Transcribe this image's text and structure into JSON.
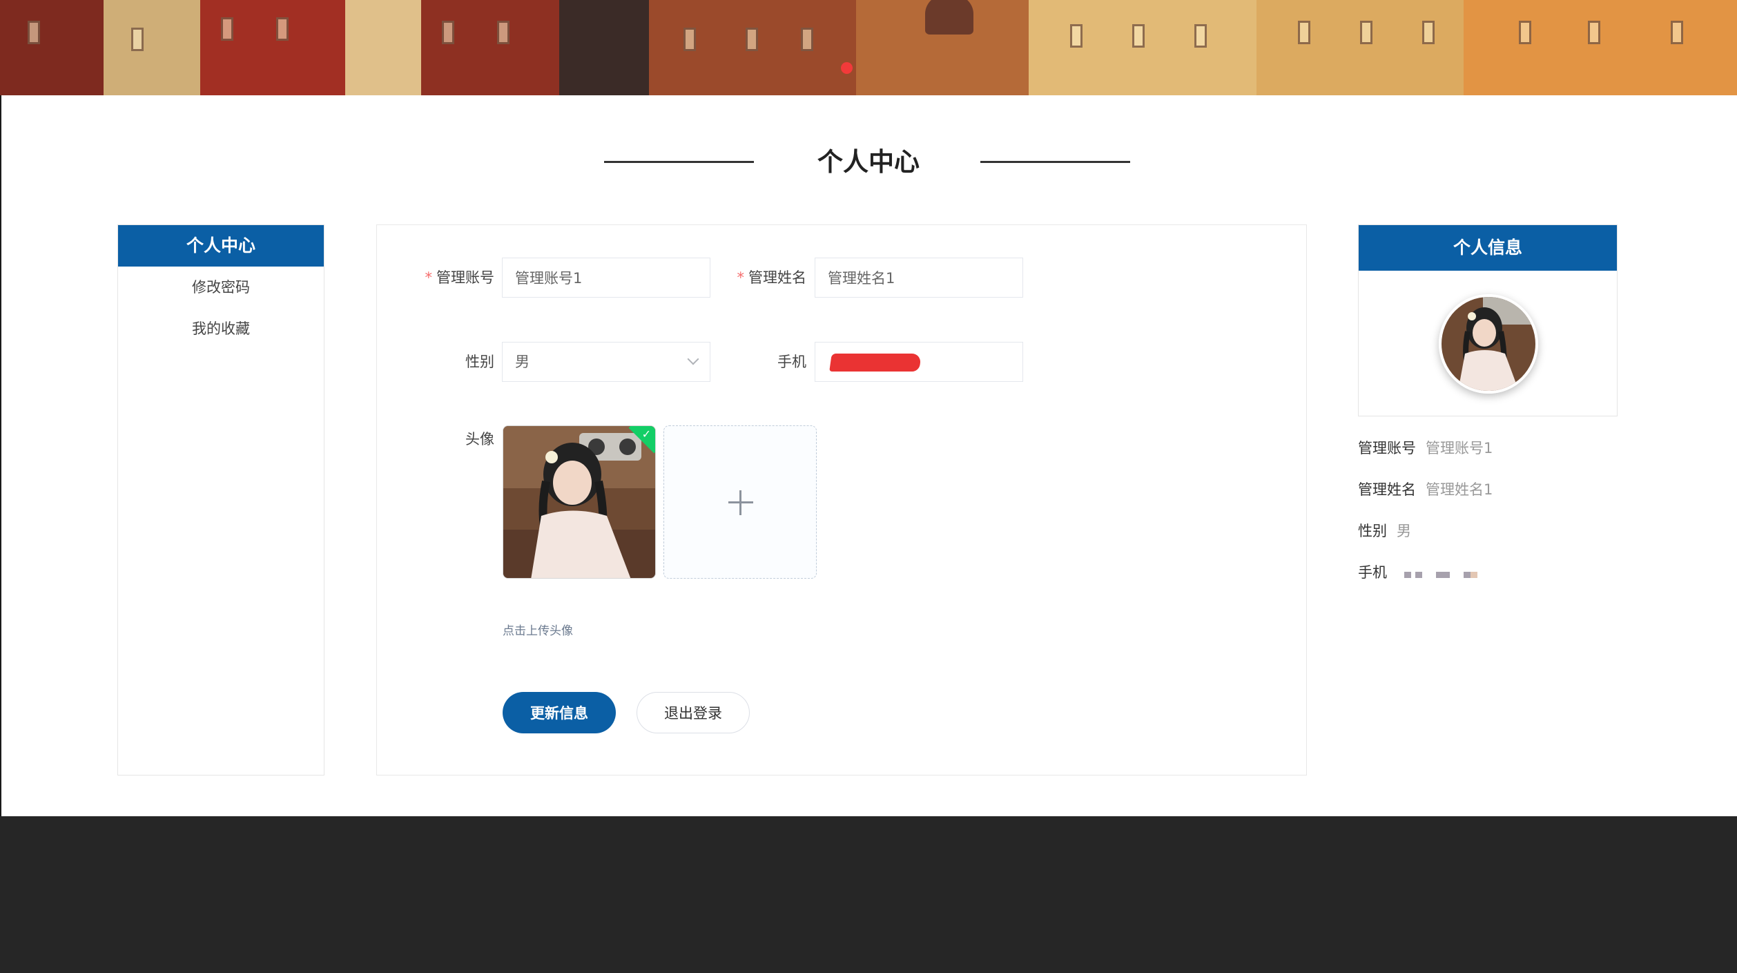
{
  "banner": {
    "image": "city-buildings-banner",
    "dot_color": "#f23a3a"
  },
  "page_title": "个人中心",
  "left_menu": {
    "header": "个人中心",
    "items": [
      "修改密码",
      "我的收藏"
    ]
  },
  "form": {
    "account_label": "管理账号",
    "account_value": "管理账号1",
    "name_label": "管理姓名",
    "name_value": "管理姓名1",
    "gender_label": "性别",
    "gender_value": "男",
    "phone_label": "手机",
    "avatar_label": "头像",
    "upload_tip": "点击上传头像",
    "update_button": "更新信息",
    "logout_button": "退出登录",
    "required_mark": "*"
  },
  "profile": {
    "header": "个人信息",
    "rows": [
      {
        "key": "管理账号",
        "value": "管理账号1"
      },
      {
        "key": "管理姓名",
        "value": "管理姓名1"
      },
      {
        "key": "性别",
        "value": "男"
      },
      {
        "key": "手机",
        "value": ""
      }
    ]
  },
  "colors": {
    "primary": "#0b5fa5",
    "footer": "#262626",
    "required": "#f56c6c",
    "success": "#13ce66"
  }
}
